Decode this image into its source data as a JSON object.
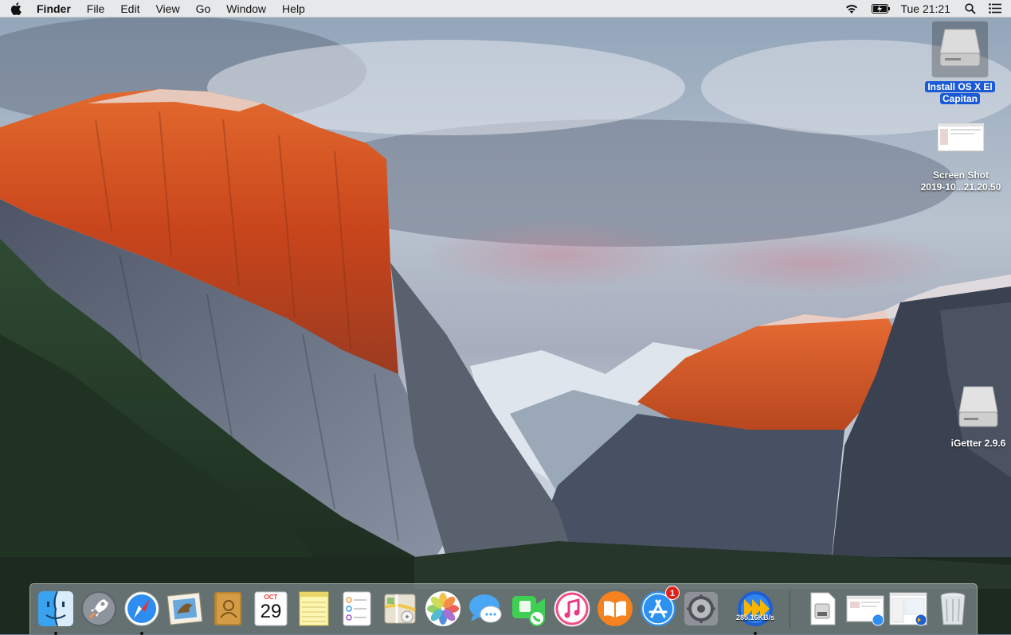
{
  "menubar": {
    "app_name": "Finder",
    "menus": [
      "File",
      "Edit",
      "View",
      "Go",
      "Window",
      "Help"
    ],
    "clock": "Tue 21:21",
    "status_icons": [
      "wifi-icon",
      "battery-charging-icon",
      "spotlight-icon",
      "notification-center-icon"
    ]
  },
  "desktop": {
    "icons": [
      {
        "label": "Install OS X El Capitan",
        "line1": "Install OS X El",
        "line2": "Capitan",
        "kind": "drive",
        "selected": true
      },
      {
        "label": "Screen Shot 2019-10...21.20.50",
        "line1": "Screen Shot",
        "line2": "2019-10...21.20.50",
        "kind": "screenshot",
        "selected": false
      },
      {
        "label": "iGetter 2.9.6",
        "line1": "iGetter 2.9.6",
        "kind": "drive",
        "selected": false
      }
    ]
  },
  "dock": {
    "apps": [
      {
        "name": "Finder",
        "icon": "finder-icon",
        "running": true
      },
      {
        "name": "Launchpad",
        "icon": "launchpad-icon",
        "running": false
      },
      {
        "name": "Safari",
        "icon": "safari-icon",
        "running": true
      },
      {
        "name": "Mail",
        "icon": "mail-icon",
        "running": false
      },
      {
        "name": "Contacts",
        "icon": "contacts-icon",
        "running": false
      },
      {
        "name": "Calendar",
        "icon": "calendar-icon",
        "running": false,
        "month": "OCT",
        "day": "29"
      },
      {
        "name": "Notes",
        "icon": "notes-icon",
        "running": false
      },
      {
        "name": "Reminders",
        "icon": "reminders-icon",
        "running": false
      },
      {
        "name": "Maps",
        "icon": "maps-icon",
        "running": false
      },
      {
        "name": "Photos",
        "icon": "photos-icon",
        "running": false
      },
      {
        "name": "Messages",
        "icon": "messages-icon",
        "running": false
      },
      {
        "name": "FaceTime",
        "icon": "facetime-icon",
        "running": false
      },
      {
        "name": "iTunes",
        "icon": "itunes-icon",
        "running": false
      },
      {
        "name": "iBooks",
        "icon": "ibooks-icon",
        "running": false
      },
      {
        "name": "App Store",
        "icon": "app-store-icon",
        "running": false,
        "badge": "1"
      },
      {
        "name": "System Preferences",
        "icon": "system-preferences-icon",
        "running": false
      },
      {
        "name": "iGetter",
        "icon": "igetter-icon",
        "running": true,
        "speed": "285.16KB/s"
      }
    ],
    "documents": [
      {
        "name": "Downloads",
        "icon": "downloads-stack-icon"
      },
      {
        "name": "Documents",
        "icon": "document-stack-icon"
      },
      {
        "name": "Screenshots",
        "icon": "screenshot-stack-icon"
      },
      {
        "name": "Trash",
        "icon": "trash-icon"
      }
    ]
  }
}
